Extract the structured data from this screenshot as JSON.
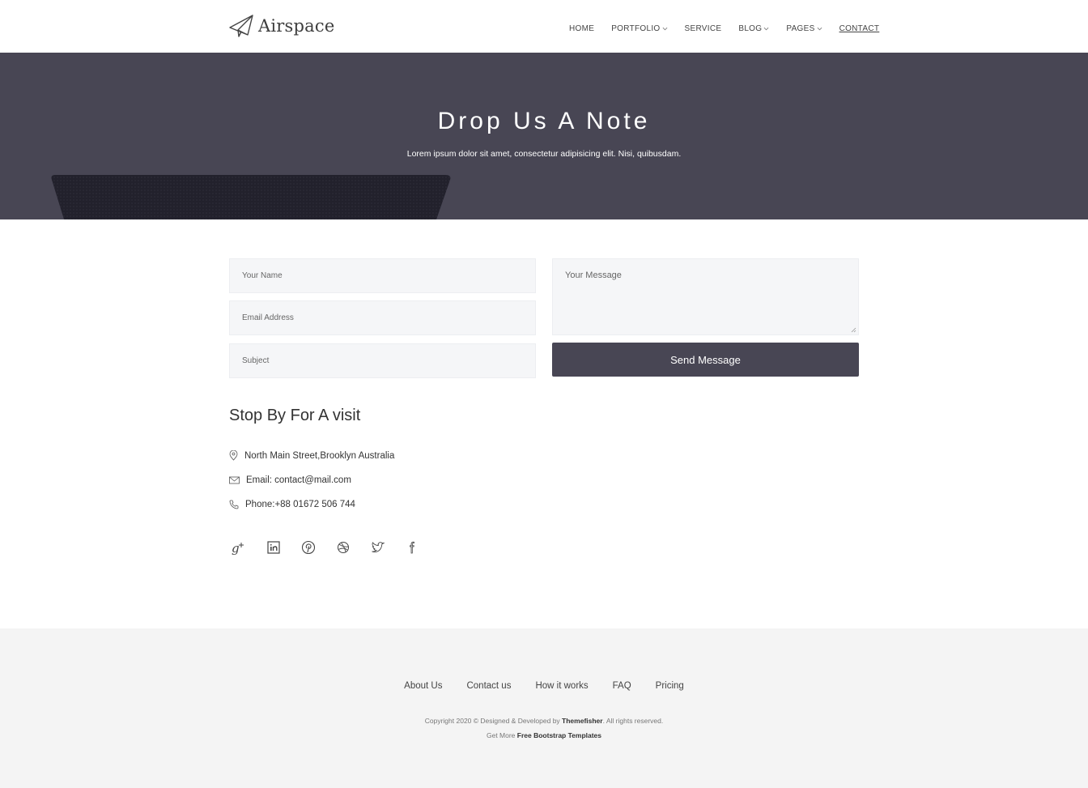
{
  "brand": {
    "name": "Airspace"
  },
  "nav": {
    "items": [
      {
        "label": "HOME",
        "dropdown": false
      },
      {
        "label": "PORTFOLIO",
        "dropdown": true
      },
      {
        "label": "SERVICE",
        "dropdown": false
      },
      {
        "label": "BLOG",
        "dropdown": true
      },
      {
        "label": "PAGES",
        "dropdown": true
      },
      {
        "label": "CONTACT",
        "dropdown": false,
        "active": true
      }
    ]
  },
  "hero": {
    "title": "Drop Us A Note",
    "subtitle": "Lorem ipsum dolor sit amet, consectetur adipisicing elit. Nisi, quibusdam."
  },
  "form": {
    "name_placeholder": "Your Name",
    "email_placeholder": "Email Address",
    "subject_placeholder": "Subject",
    "message_placeholder": "Your Message",
    "submit_label": "Send Message"
  },
  "visit": {
    "title": "Stop By For A visit",
    "address": "North Main Street,Brooklyn Australia",
    "email": "Email: contact@mail.com",
    "phone": "Phone:+88 01672 506 744"
  },
  "socials": [
    "google-plus-icon",
    "linkedin-icon",
    "pinterest-icon",
    "dribbble-icon",
    "twitter-icon",
    "facebook-icon"
  ],
  "footer": {
    "links": [
      "About Us",
      "Contact us",
      "How it works",
      "FAQ",
      "Pricing"
    ],
    "copyright_prefix": "Copyright 2020 © Designed & Developed by ",
    "copyright_brand": "Themefisher",
    "copyright_suffix": ". All rights reserved.",
    "more_prefix": "Get More ",
    "more_link": "Free Bootstrap Templates"
  },
  "colors": {
    "primary": "#484654",
    "field_bg": "#f5f6f8",
    "footer_bg": "#f4f4f4"
  }
}
